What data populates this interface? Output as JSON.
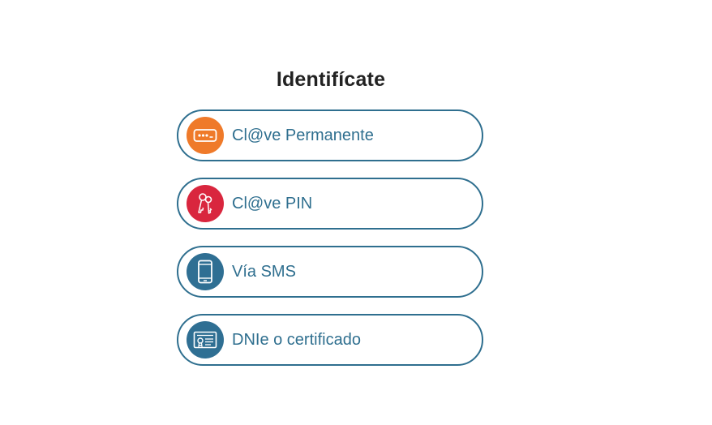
{
  "title": "Identifícate",
  "options": [
    {
      "label": "Cl@ve Permanente",
      "icon": "password-field-icon",
      "color": "#ef7a2a"
    },
    {
      "label": "Cl@ve PIN",
      "icon": "keys-icon",
      "color": "#d9263e"
    },
    {
      "label": "Vía SMS",
      "icon": "mobile-phone-icon",
      "color": "#2f6f93"
    },
    {
      "label": "DNIe o certificado",
      "icon": "certificate-icon",
      "color": "#2f6f93"
    }
  ]
}
